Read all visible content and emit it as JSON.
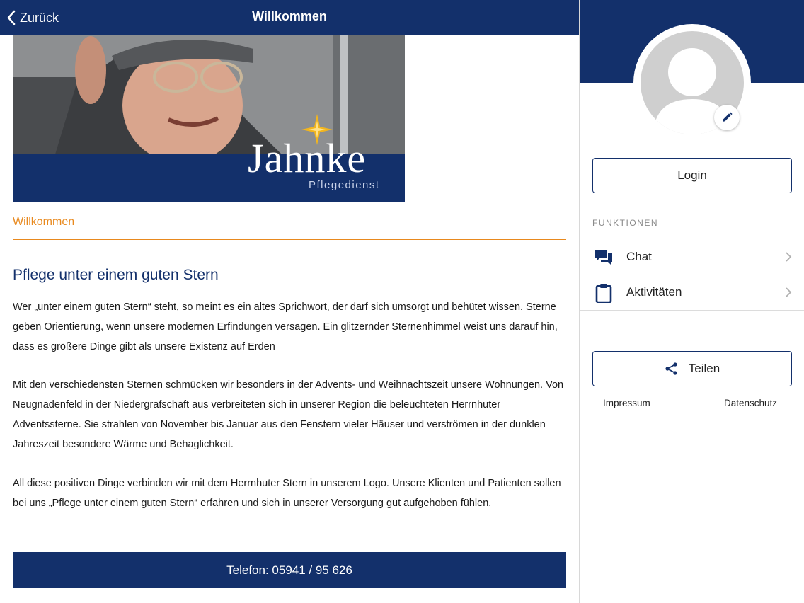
{
  "topbar": {
    "back_label": "Zurück",
    "title": "Willkommen"
  },
  "hero": {
    "brand_name": "Jahnke",
    "brand_sub": "Pflegedienst"
  },
  "content": {
    "section_tab": "Willkommen",
    "title": "Pflege unter einem guten Stern",
    "paragraphs": [
      "Wer „unter einem guten Stern“ steht, so meint es ein altes Sprichwort, der darf sich umsorgt und behütet wissen. Sterne geben Orientierung, wenn unsere modernen Erfindungen versagen. Ein glitzernder Sternenhimmel weist uns darauf hin, dass es größere Dinge gibt als unsere Existenz auf Erden",
      "Mit den verschiedensten Sternen schmücken wir besonders in der Advents- und Weihnachtszeit unsere Wohnungen. Von Neugnadenfeld in der Niedergrafschaft aus verbreiteten sich in unserer Region die beleuchteten Herrnhuter Adventssterne. Sie strahlen von November bis Januar aus den Fenstern vieler Häuser und verströmen in der dunklen Jahreszeit besondere Wärme und Behaglichkeit.",
      "All diese positiven Dinge verbinden wir mit dem Herrnhuter Stern in unserem Logo. Unsere Klienten und Patienten sollen bei uns „Pflege unter einem guten Stern“ erfahren und sich in unserer Versorgung gut aufgehoben fühlen."
    ],
    "phone_label": "Telefon: 05941 / 95 626"
  },
  "sidebar": {
    "login_label": "Login",
    "functions_label": "FUNKTIONEN",
    "items": [
      {
        "label": "Chat",
        "icon": "chat-icon"
      },
      {
        "label": "Aktivitäten",
        "icon": "clipboard-icon"
      }
    ],
    "share_label": "Teilen",
    "impressum_label": "Impressum",
    "datenschutz_label": "Datenschutz"
  },
  "colors": {
    "brand_navy": "#13306b",
    "accent_orange": "#e8891e",
    "star_gold": "#f2b51e"
  }
}
